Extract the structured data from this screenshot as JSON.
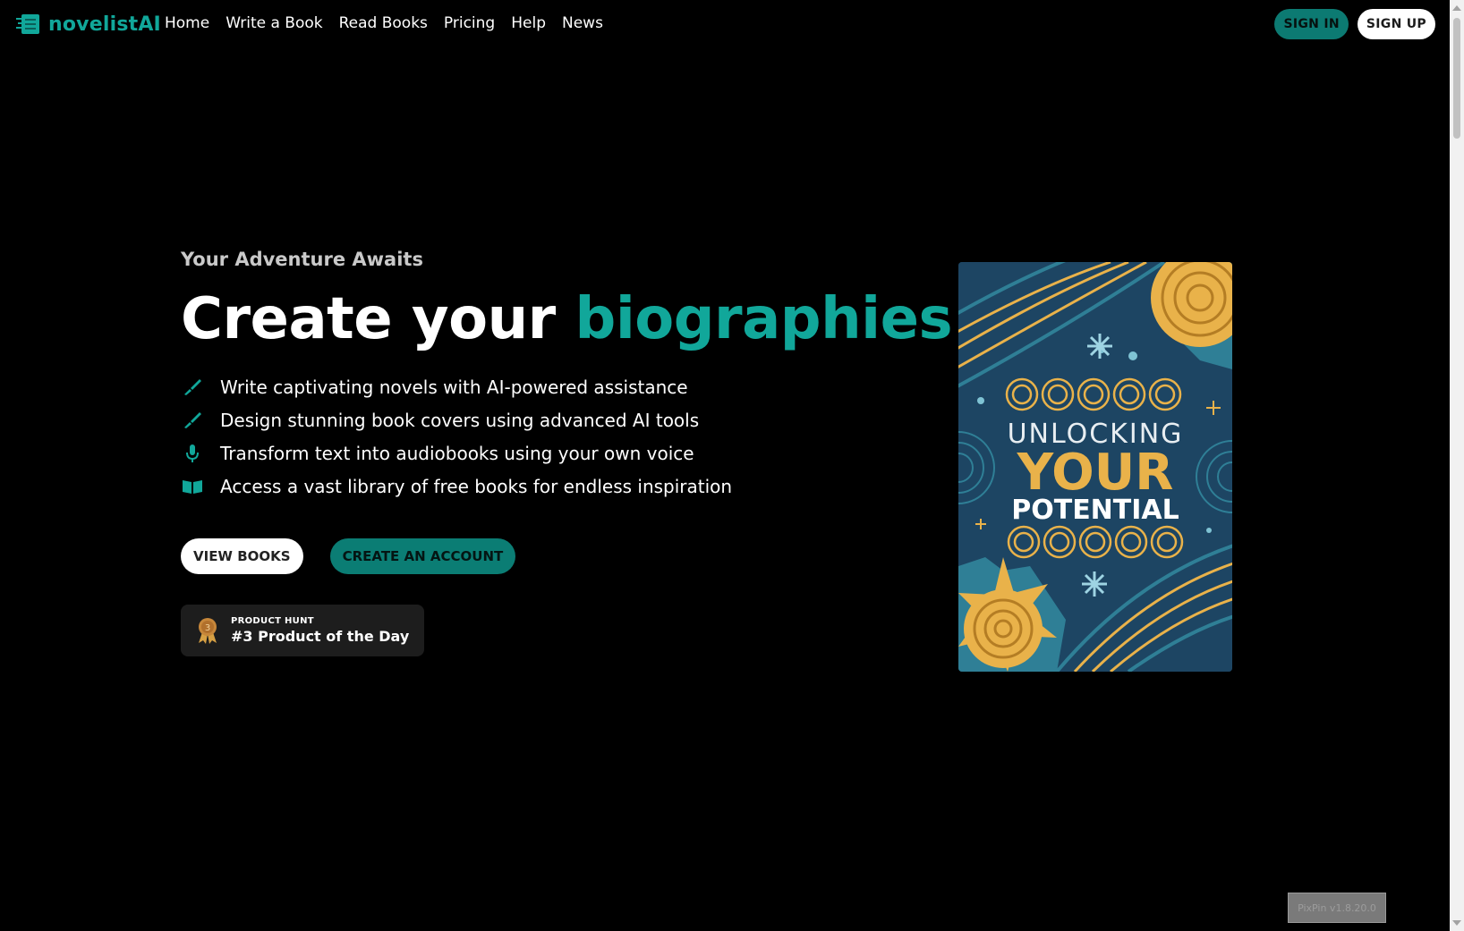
{
  "brand": {
    "name": "novelistAI",
    "accent": "#11a79a"
  },
  "nav": {
    "items": [
      {
        "label": "Home"
      },
      {
        "label": "Write a Book"
      },
      {
        "label": "Read Books"
      },
      {
        "label": "Pricing"
      },
      {
        "label": "Help"
      },
      {
        "label": "News"
      }
    ]
  },
  "auth": {
    "sign_in": "SIGN IN",
    "sign_up": "SIGN UP"
  },
  "hero": {
    "eyebrow": "Your Adventure Awaits",
    "headline_prefix": "Create your",
    "headline_accent": "biographies",
    "features": [
      {
        "icon": "brush-icon",
        "text": "Write captivating novels with AI-powered assistance"
      },
      {
        "icon": "brush-icon",
        "text": "Design stunning book covers using advanced AI tools"
      },
      {
        "icon": "microphone-icon",
        "text": "Transform text into audiobooks using your own voice"
      },
      {
        "icon": "book-open-icon",
        "text": "Access a vast library of free books for endless inspiration"
      }
    ],
    "cta_view": "VIEW BOOKS",
    "cta_create": "CREATE AN ACCOUNT",
    "badge": {
      "top": "PRODUCT HUNT",
      "main": "#3 Product of the Day",
      "medal_number": "3"
    }
  },
  "cover": {
    "line1": "UNLOCKING",
    "line2": "YOUR",
    "line3": "POTENTIAL",
    "colors": {
      "bg": "#1d4563",
      "gold": "#e9b24a",
      "teal": "#2f7f96"
    }
  },
  "watermark": "PixPin v1.8.20.0"
}
